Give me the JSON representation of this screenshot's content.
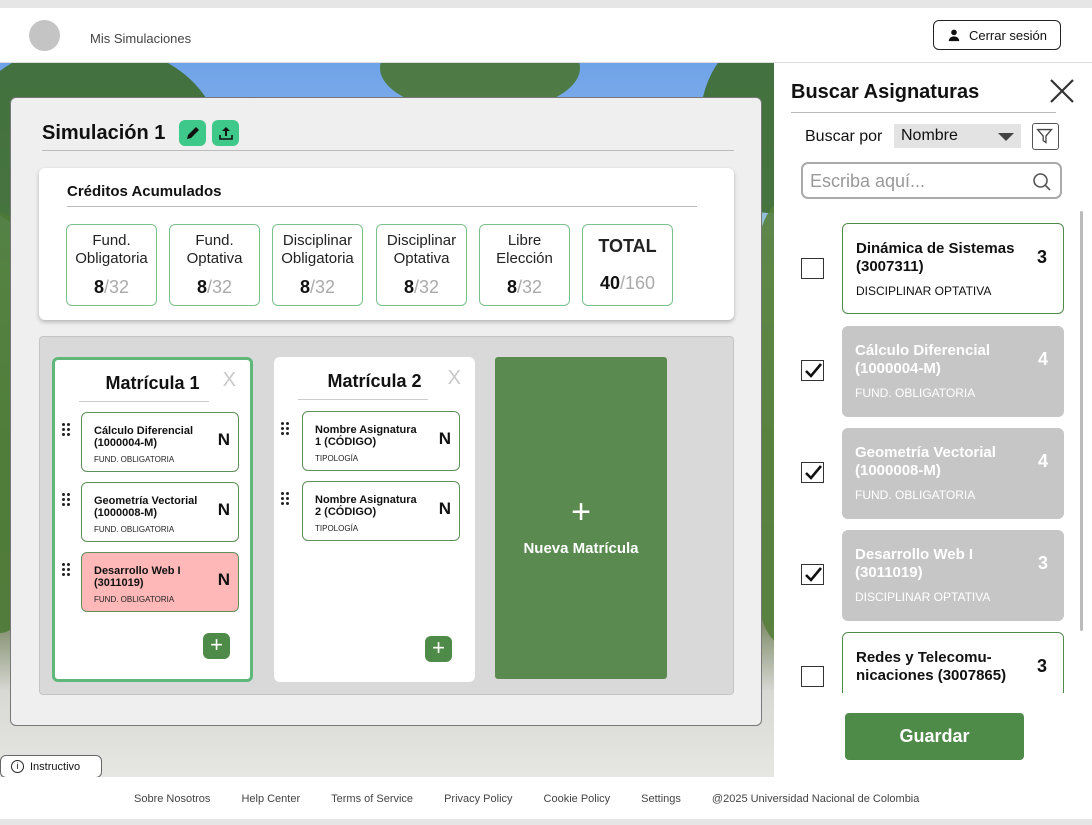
{
  "header": {
    "nav_link": "Mis Simulaciones",
    "logout_label": "Cerrar sesión"
  },
  "simulation": {
    "title": "Simulación 1",
    "credits_title": "Créditos Acumulados",
    "credits": [
      {
        "label_1": "Fund.",
        "label_2": "Obligatoria",
        "value": "8",
        "max": "/32"
      },
      {
        "label_1": "Fund.",
        "label_2": "Optativa",
        "value": "8",
        "max": "/32"
      },
      {
        "label_1": "Disciplinar",
        "label_2": "Obligatoria",
        "value": "8",
        "max": "/32"
      },
      {
        "label_1": "Disciplinar",
        "label_2": "Optativa",
        "value": "8",
        "max": "/32"
      },
      {
        "label_1": "Libre",
        "label_2": "Elección",
        "value": "8",
        "max": "/32"
      }
    ],
    "total": {
      "label": "TOTAL",
      "value": "40",
      "max": "/160"
    }
  },
  "matriculas": [
    {
      "title": "Matrícula 1",
      "close": "X",
      "courses": [
        {
          "name": "Cálculo Diferencial (1000004-M)",
          "type": "FUND. OBLIGATORIA",
          "badge": "N"
        },
        {
          "name": "Geometría Vectorial (1000008-M)",
          "type": "FUND. OBLIGATORIA",
          "badge": "N"
        },
        {
          "name": "Desarrollo Web I (3011019)",
          "type": "FUND. OBLIGATORIA",
          "badge": "N"
        }
      ],
      "add": "+"
    },
    {
      "title": "Matrícula 2",
      "close": "X",
      "courses": [
        {
          "name": "Nombre Asignatura 1 (CÓDIGO)",
          "type": "TIPOLOGÍA",
          "badge": "N"
        },
        {
          "name": "Nombre Asignatura 2 (CÓDIGO)",
          "type": "TIPOLOGÍA",
          "badge": "N"
        }
      ],
      "add": "+"
    }
  ],
  "new_matricula": {
    "plus": "+",
    "label": "Nueva Matrícula"
  },
  "instructivo": {
    "icon": "i",
    "label": "Instructivo"
  },
  "search_panel": {
    "title": "Buscar Asignaturas",
    "search_by_label": "Buscar por",
    "search_by_value": "Nombre",
    "search_placeholder": "Escriba aquí...",
    "results": [
      {
        "name": "Dinámica de Sistemas (3007311)",
        "type": "DISCIPLINAR OPTATIVA",
        "credits": "3",
        "checked": false
      },
      {
        "name": "Cálculo Diferencial (1000004-M)",
        "type": "FUND. OBLIGATORIA",
        "credits": "4",
        "checked": true
      },
      {
        "name": "Geometría Vectorial (1000008-M)",
        "type": "FUND. OBLIGATORIA",
        "credits": "4",
        "checked": true
      },
      {
        "name": "Desarrollo Web I (3011019)",
        "type": "DISCIPLINAR OPTATIVA",
        "credits": "3",
        "checked": true
      },
      {
        "name": "Redes y Telecomu-nicaciones (3007865)",
        "type": "",
        "credits": "3",
        "checked": false
      }
    ],
    "save_label": "Guardar"
  },
  "footer": {
    "links": [
      "Sobre Nosotros",
      "Help Center",
      "Terms of Service",
      "Privacy Policy",
      "Cookie Policy",
      "Settings",
      "@2025 Universidad Nacional de Colombia"
    ]
  },
  "colors": {
    "accent_green": "#4e8a48",
    "light_green": "#3ec98a",
    "border_green": "#7cc08a",
    "error_red": "#ffb8b8",
    "disabled_gray": "#c6c6c6"
  }
}
